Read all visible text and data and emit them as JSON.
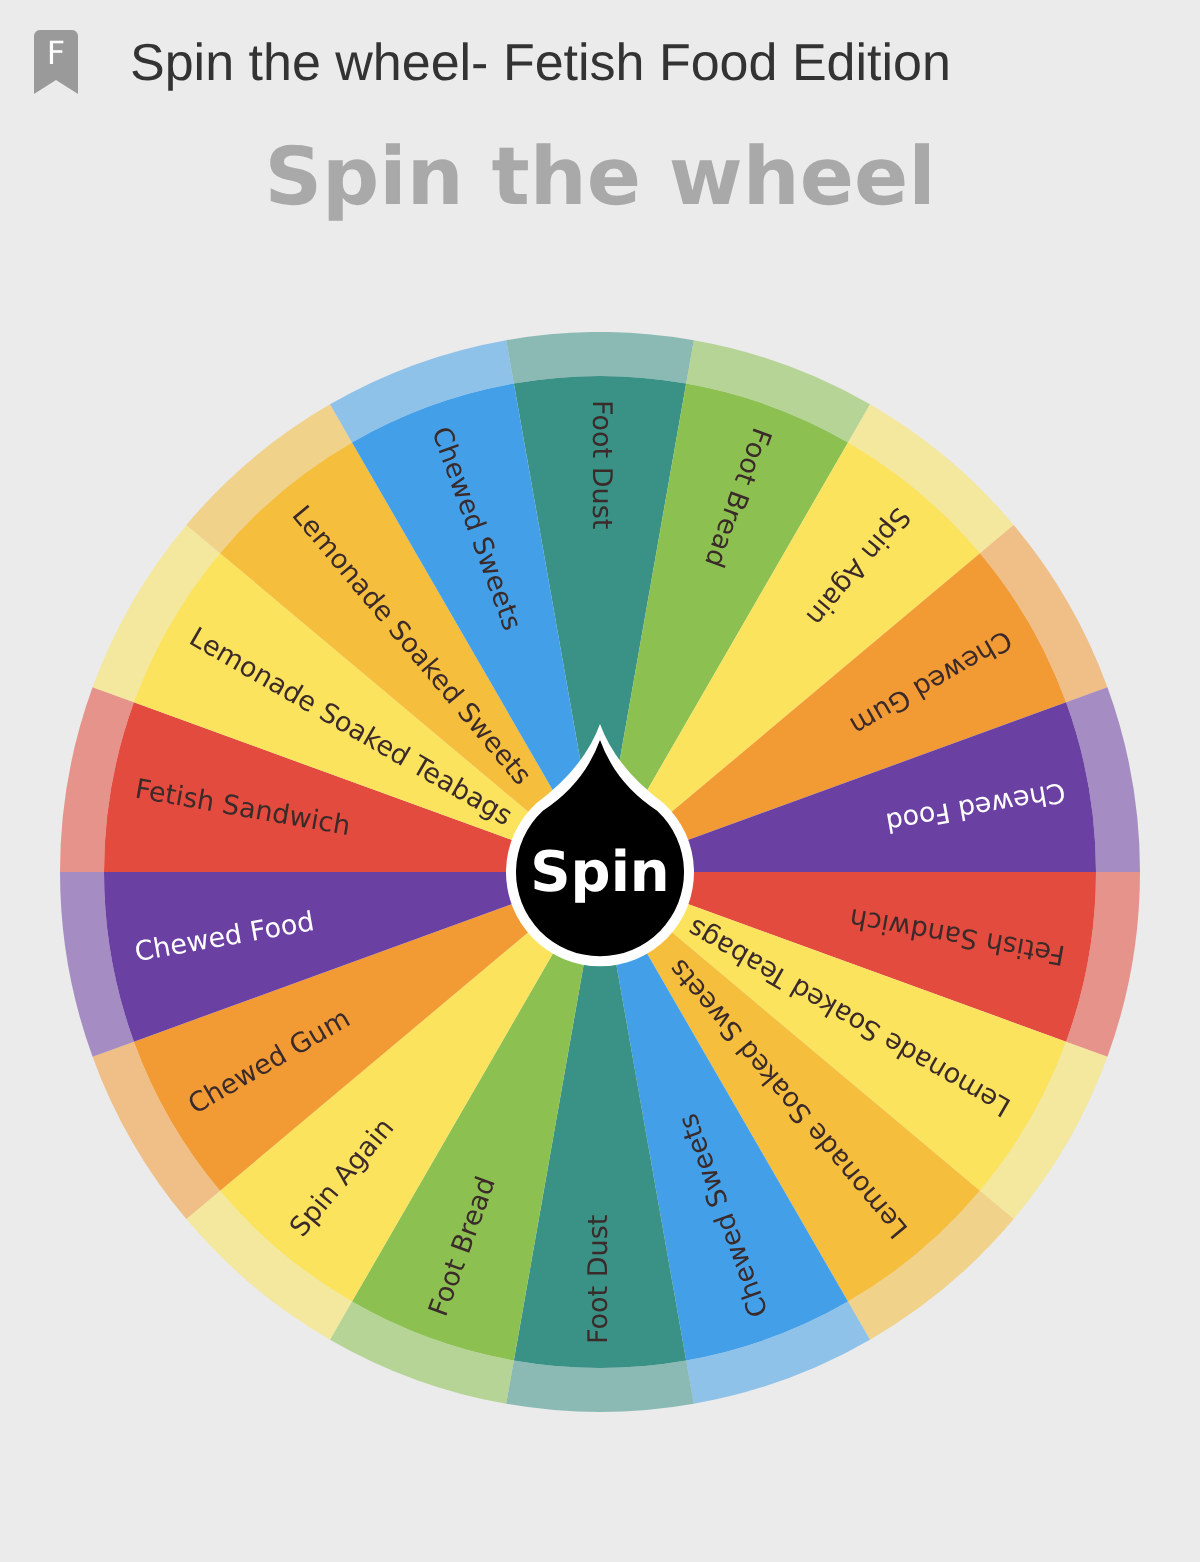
{
  "header": {
    "app_icon_letter": "F",
    "title": "Spin the wheel- Fetish Food Edition"
  },
  "heading": "Spin the wheel",
  "wheel": {
    "spin_button": "Spin",
    "segments": [
      {
        "label": "Foot Dust",
        "color": "#3a9185"
      },
      {
        "label": "Foot Bread",
        "color": "#8cc152"
      },
      {
        "label": "Spin Again",
        "color": "#fbe35e"
      },
      {
        "label": "Chewed Gum",
        "color": "#f29b35"
      },
      {
        "label": "Chewed Food",
        "color": "#6b40a3"
      },
      {
        "label": "Fetish Sandwich",
        "color": "#e24b3d"
      },
      {
        "label": "Lemonade Soaked Teabags",
        "color": "#fbe35e"
      },
      {
        "label": "Lemonade Soaked Sweets",
        "color": "#f5be3d"
      },
      {
        "label": "Chewed Sweets",
        "color": "#43a0e8"
      },
      {
        "label": "Foot Dust",
        "color": "#3a9185"
      },
      {
        "label": "Foot Bread",
        "color": "#8cc152"
      },
      {
        "label": "Spin Again",
        "color": "#fbe35e"
      },
      {
        "label": "Chewed Gum",
        "color": "#f29b35"
      },
      {
        "label": "Chewed Food",
        "color": "#6b40a3"
      },
      {
        "label": "Fetish Sandwich",
        "color": "#e24b3d"
      },
      {
        "label": "Lemonade Soaked Teabags",
        "color": "#fbe35e"
      },
      {
        "label": "Lemonade Soaked Sweets",
        "color": "#f5be3d"
      },
      {
        "label": "Chewed Sweets",
        "color": "#43a0e8"
      }
    ]
  }
}
